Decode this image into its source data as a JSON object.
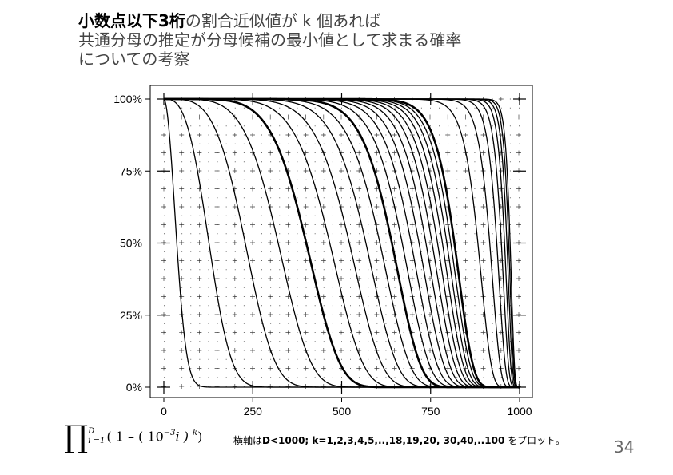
{
  "slide": {
    "title_lines": [
      {
        "emph": "小数点以下3桁",
        "rest": "の割合近似値が k 個あれば"
      },
      {
        "emph": "",
        "rest": "共通分母の推定が分母候補の最小値として求まる確率"
      },
      {
        "emph": "",
        "rest": "についての考察"
      }
    ],
    "formula": {
      "prod": "∏",
      "upper": "D",
      "lower": "i =1",
      "body_left": "( 1 – ( 10",
      "exp": "−3",
      "body_right": "i ) ",
      "power": "k",
      "close": ")"
    },
    "caption": {
      "prefix": "横軸は",
      "bold": "D<1000; k=1,2,3,4,5,..,18,19,20,  30,40,..100",
      "suffix": " をプロット。"
    },
    "page_number": "34"
  },
  "chart_data": {
    "type": "line",
    "title": "",
    "xlabel": "",
    "ylabel": "",
    "xlim": [
      0,
      1000
    ],
    "ylim": [
      0,
      1
    ],
    "x_ticks": [
      0,
      250,
      500,
      750,
      1000
    ],
    "y_ticks": [
      0,
      0.25,
      0.5,
      0.75,
      1.0
    ],
    "x_tick_labels": [
      "0",
      "250",
      "500",
      "750",
      "1000"
    ],
    "y_tick_labels": [
      "0%",
      "25%",
      "50%",
      "75%",
      "100%"
    ],
    "grid": "dotted",
    "function": "y = prod_{i=1}^{D} (1 - (0.001*i)^k)",
    "k_values": [
      1,
      2,
      3,
      4,
      5,
      6,
      7,
      8,
      9,
      10,
      11,
      12,
      13,
      14,
      15,
      16,
      17,
      18,
      19,
      20,
      30,
      40,
      50,
      60,
      70,
      80,
      90,
      100
    ],
    "bold_k_values": [
      5,
      10,
      20
    ],
    "colors": {
      "line": "#000000",
      "grid": "#555555",
      "frame": "#000000"
    }
  }
}
